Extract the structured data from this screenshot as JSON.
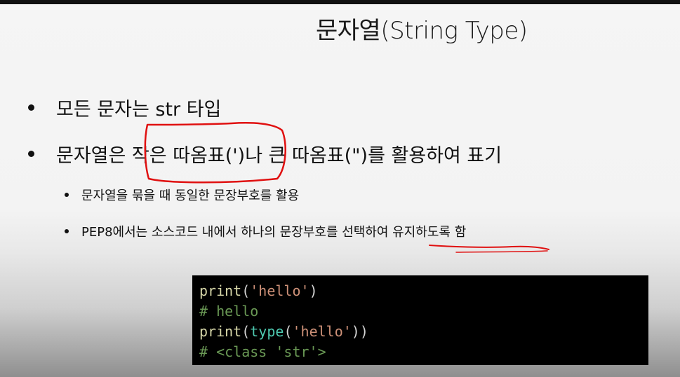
{
  "slide": {
    "title": "문자열(String Type)",
    "bullets": [
      "모든 문자는 str 타입",
      "문자열은 작은 따옴표(')나 큰 따옴표(\")를 활용하여 표기"
    ],
    "sub_bullets": [
      "문자열을 묶을 때 동일한 문장부호를 활용",
      "PEP8에서는 소스코드 내에서 하나의 문장부호를 선택하여 유지하도록 함"
    ]
  },
  "code": {
    "line1": {
      "fn": "print",
      "open": "(",
      "str": "'hello'",
      "close": ")"
    },
    "line2": "# hello",
    "line3": {
      "fn": "print",
      "open": "(",
      "bi": "type",
      "open2": "(",
      "str": "'hello'",
      "close": "))"
    },
    "line4": "# <class 'str'>"
  },
  "colors": {
    "annotation": "#e01010",
    "code_background": "#000000"
  }
}
